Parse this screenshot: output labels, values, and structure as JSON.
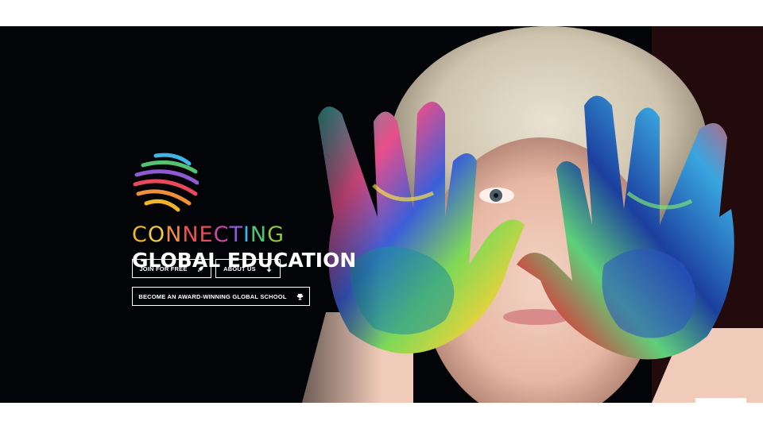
{
  "hero": {
    "headline_line1": [
      "C",
      "O",
      "N",
      "N",
      "E",
      "C",
      "T",
      "I",
      "N",
      "G"
    ],
    "headline_line1_colors": [
      "#f0b429",
      "#f0c94a",
      "#ee8f3a",
      "#e8544f",
      "#e94a5b",
      "#c64a9d",
      "#8d5bd0",
      "#3fb6e8",
      "#56c170",
      "#8dc63f"
    ],
    "headline_line2": "GLOBAL EDUCATION"
  },
  "buttons": {
    "join_label": "JOIN FOR FREE",
    "join_icon": "rocket-icon",
    "about_label": "ABOUT US",
    "about_icon": "arrow-down-icon",
    "award_label": "BECOME AN AWARD-WINNING GLOBAL SCHOOL",
    "award_icon": "trophy-icon"
  },
  "colors": {
    "background": "#030407",
    "text": "#ffffff",
    "logo_stripes": [
      "#3fb6e8",
      "#56c170",
      "#8d5bd0",
      "#e94a5b",
      "#ee8f3a",
      "#f0b429"
    ]
  }
}
